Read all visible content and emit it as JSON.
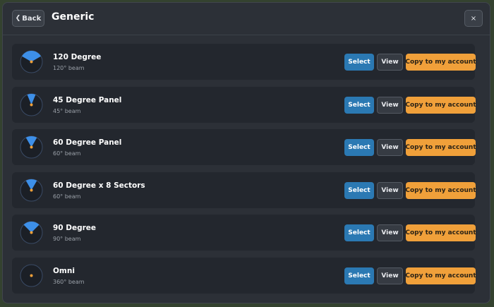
{
  "header": {
    "back_label": "Back",
    "title": "Generic",
    "close_label": "×"
  },
  "items": [
    {
      "name": "120 Degree",
      "sub": "120° beam",
      "beam_deg": 120
    },
    {
      "name": "45 Degree Panel",
      "sub": "45° beam",
      "beam_deg": 45
    },
    {
      "name": "60 Degree Panel",
      "sub": "60° beam",
      "beam_deg": 60
    },
    {
      "name": "60 Degree x 8 Sectors",
      "sub": "60° beam",
      "beam_deg": 60
    },
    {
      "name": "90 Degree",
      "sub": "90° beam",
      "beam_deg": 90
    },
    {
      "name": "Omni",
      "sub": "360° beam",
      "beam_deg": 360
    }
  ],
  "buttons": {
    "select_label": "Select",
    "view_label": "View",
    "copy_label": "Copy to my account"
  },
  "colors": {
    "beam_fill": "#3d8fe8",
    "center_dot": "#f0a03a",
    "select_bg": "#2b79b3",
    "copy_bg": "#f0a03a"
  },
  "icons": {
    "back": "chevron-left-icon",
    "close": "close-icon",
    "beam": "antenna-beam-icon"
  }
}
